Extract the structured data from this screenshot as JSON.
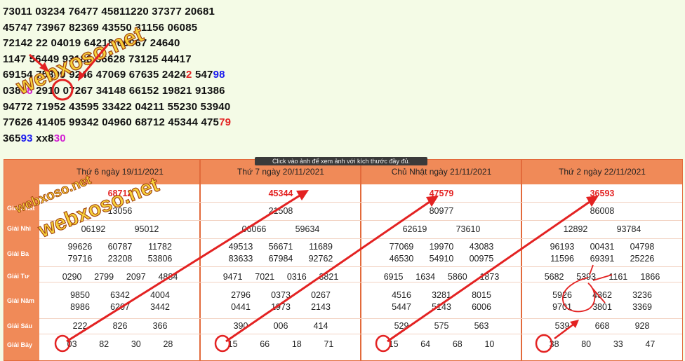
{
  "numbers_block": {
    "rows": [
      [
        {
          "t": "73011 03234 76477 4581"
        },
        {
          "t": "1220 37377 20681"
        }
      ],
      [
        {
          "t": "45747 73967 823"
        },
        {
          "t": "69 43550 31156 06085"
        }
      ],
      [
        {
          "t": "72142 "
        },
        {
          "t": "22 04019 64218 66067 24640"
        }
      ],
      [
        {
          "t": "11"
        },
        {
          "t": "47 56449 93188 56628 73125 44417"
        }
      ],
      [
        {
          "t": "69154 753"
        },
        {
          "t": "09 92"
        },
        {
          "t": "46 47069 67635 2424"
        },
        {
          "t": "2",
          "c": "red"
        },
        {
          "t": " 547"
        },
        {
          "t": "98",
          "c": "blue"
        }
      ],
      [
        {
          "t": "038"
        },
        {
          "t": "58",
          "c": "magenta"
        },
        {
          "t": " 29"
        },
        {
          "t": "10"
        },
        {
          "t": " 07267 34148 66152 19821 91386"
        }
      ],
      [
        {
          "t": "94772 71952 43595 33422 04211 55230 53940"
        }
      ],
      [
        {
          "t": "77626 41405 99342 04960 68712 45344 475"
        },
        {
          "t": "79",
          "c": "red"
        }
      ],
      [
        {
          "t": "365"
        },
        {
          "t": "93",
          "c": "blue"
        },
        {
          "t": " xx8"
        },
        {
          "t": "30",
          "c": "magenta"
        }
      ]
    ]
  },
  "tooltip": "Click vào ảnh để xem ảnh với kích thước đầy đủ.",
  "watermarks": [
    "webxoso.net",
    "webxoso.net",
    "webxoso.net"
  ],
  "row_labels": [
    "Giải Nhất",
    "Giải Nhì",
    "Giải Ba",
    "Giải Tư",
    "Giải Năm",
    "Giải Sáu",
    "Giải Bảy"
  ],
  "columns": [
    {
      "header": "Thứ 6 ngày 19/11/2021",
      "special": "68712",
      "g1": [
        "13056"
      ],
      "g2": [
        "06192",
        "95012"
      ],
      "g3": [
        "99626",
        "60787",
        "11782",
        "79716",
        "23208",
        "53806"
      ],
      "g4": [
        "0290",
        "2799",
        "2097",
        "4884"
      ],
      "g5": [
        "9850",
        "6342",
        "4004",
        "8986",
        "6207",
        "3442"
      ],
      "g6": [
        "222",
        "826",
        "366"
      ],
      "g7": [
        "03",
        "82",
        "30",
        "28"
      ]
    },
    {
      "header": "Thứ 7 ngày 20/11/2021",
      "special": "45344",
      "g1": [
        "21508"
      ],
      "g2": [
        "06066",
        "59634"
      ],
      "g3": [
        "49513",
        "56671",
        "11689",
        "83633",
        "67984",
        "92762"
      ],
      "g4": [
        "9471",
        "7021",
        "0316",
        "3821"
      ],
      "g5": [
        "2796",
        "0373",
        "0267",
        "0441",
        "1973",
        "2143"
      ],
      "g6": [
        "390",
        "006",
        "414"
      ],
      "g7": [
        "15",
        "66",
        "18",
        "71"
      ]
    },
    {
      "header": "Chủ Nhật ngày 21/11/2021",
      "special": "47579",
      "g1": [
        "80977"
      ],
      "g2": [
        "62619",
        "73610"
      ],
      "g3": [
        "77069",
        "19970",
        "43083",
        "46530",
        "54910",
        "00975"
      ],
      "g4": [
        "6915",
        "1634",
        "5860",
        "1873"
      ],
      "g5": [
        "4516",
        "3281",
        "8015",
        "5447",
        "5143",
        "6006"
      ],
      "g6": [
        "529",
        "575",
        "563"
      ],
      "g7": [
        "15",
        "64",
        "68",
        "10"
      ]
    },
    {
      "header": "Thứ 2 ngày 22/11/2021",
      "special": "36593",
      "g1": [
        "86008"
      ],
      "g2": [
        "12892",
        "93784"
      ],
      "g3": [
        "96193",
        "00431",
        "04798",
        "11596",
        "69391",
        "25226"
      ],
      "g4": [
        "5682",
        "5393",
        "1161",
        "1866"
      ],
      "g5": [
        "5926",
        "4362",
        "3236",
        "9701",
        "3801",
        "3369"
      ],
      "g6": [
        "539",
        "668",
        "928"
      ],
      "g7": [
        "38",
        "80",
        "33",
        "47"
      ]
    }
  ],
  "colors": {
    "header_bg": "#f08a58",
    "annotation": "#e32222",
    "page_bg": "#f4fbe6"
  }
}
